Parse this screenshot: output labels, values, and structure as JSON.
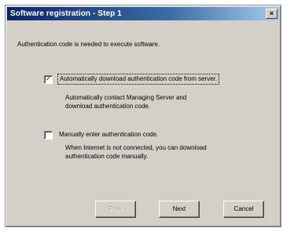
{
  "window": {
    "title": "Software registration - Step 1",
    "close_glyph": "×"
  },
  "intro": "Authentication code is needed to execute software.",
  "options": [
    {
      "label": "Automatically download authentication code from server.",
      "checked_glyph": "✓",
      "description_lines": [
        "Automatically contact Managing Server and",
        "download authentication code."
      ]
    },
    {
      "label": "Manually enter authentication code.",
      "checked_glyph": "",
      "description_lines": [
        "When Internet is not connected, you can download",
        "authentication code manually."
      ]
    }
  ],
  "buttons": {
    "back": "Prev",
    "next": "Next",
    "cancel": "Cancel"
  }
}
